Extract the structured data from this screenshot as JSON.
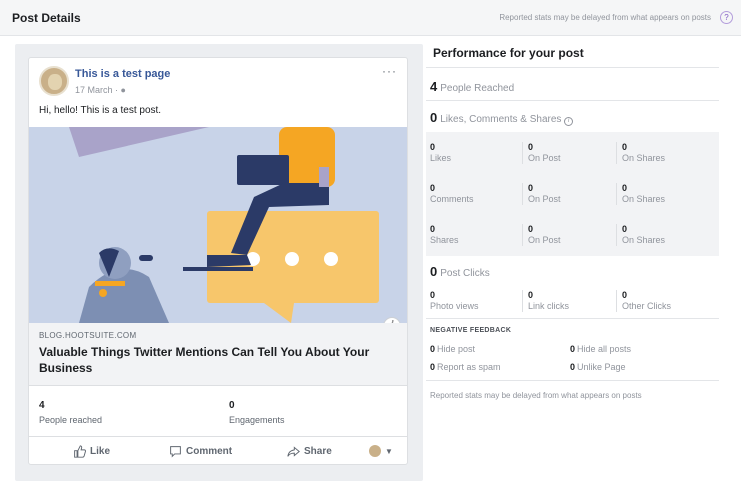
{
  "header": {
    "title": "Post Details",
    "note": "Reported stats may be delayed from what appears on posts",
    "help_glyph": "?"
  },
  "post": {
    "page_name": "This is a test page",
    "date": "17 March · ",
    "more_glyph": "···",
    "text": "Hi, hello! This is a test post.",
    "link_domain": "BLOG.HOOTSUITE.COM",
    "link_title": "Valuable Things Twitter Mentions Can Tell You About Your Business",
    "info_glyph": "i",
    "stats": [
      {
        "value": "4",
        "label": "People reached"
      },
      {
        "value": "0",
        "label": "Engagements"
      }
    ],
    "actions": {
      "like": "Like",
      "comment": "Comment",
      "share": "Share"
    }
  },
  "performance": {
    "title": "Performance for your post",
    "reached": {
      "value": "4",
      "label": "People Reached"
    },
    "engagement": {
      "value": "0",
      "label": "Likes, Comments & Shares"
    },
    "grid": [
      [
        {
          "value": "0",
          "label": "Likes"
        },
        {
          "value": "0",
          "label": "On Post"
        },
        {
          "value": "0",
          "label": "On Shares"
        }
      ],
      [
        {
          "value": "0",
          "label": "Comments"
        },
        {
          "value": "0",
          "label": "On Post"
        },
        {
          "value": "0",
          "label": "On Shares"
        }
      ],
      [
        {
          "value": "0",
          "label": "Shares"
        },
        {
          "value": "0",
          "label": "On Post"
        },
        {
          "value": "0",
          "label": "On Shares"
        }
      ]
    ],
    "clicks": {
      "value": "0",
      "label": "Post Clicks"
    },
    "click_breakdown": [
      {
        "value": "0",
        "label": "Photo views"
      },
      {
        "value": "0",
        "label": "Link clicks"
      },
      {
        "value": "0",
        "label": "Other Clicks"
      }
    ],
    "negative_title": "NEGATIVE FEEDBACK",
    "negative": [
      {
        "value": "0",
        "label": "Hide post"
      },
      {
        "value": "0",
        "label": "Hide all posts"
      },
      {
        "value": "0",
        "label": "Report as spam"
      },
      {
        "value": "0",
        "label": "Unlike Page"
      }
    ],
    "footer": "Reported stats may be delayed from what appears on posts"
  },
  "colors": {
    "link_blue": "#385898",
    "accent_orange": "#f7c66b",
    "illus_bg": "#c8d3e8"
  }
}
